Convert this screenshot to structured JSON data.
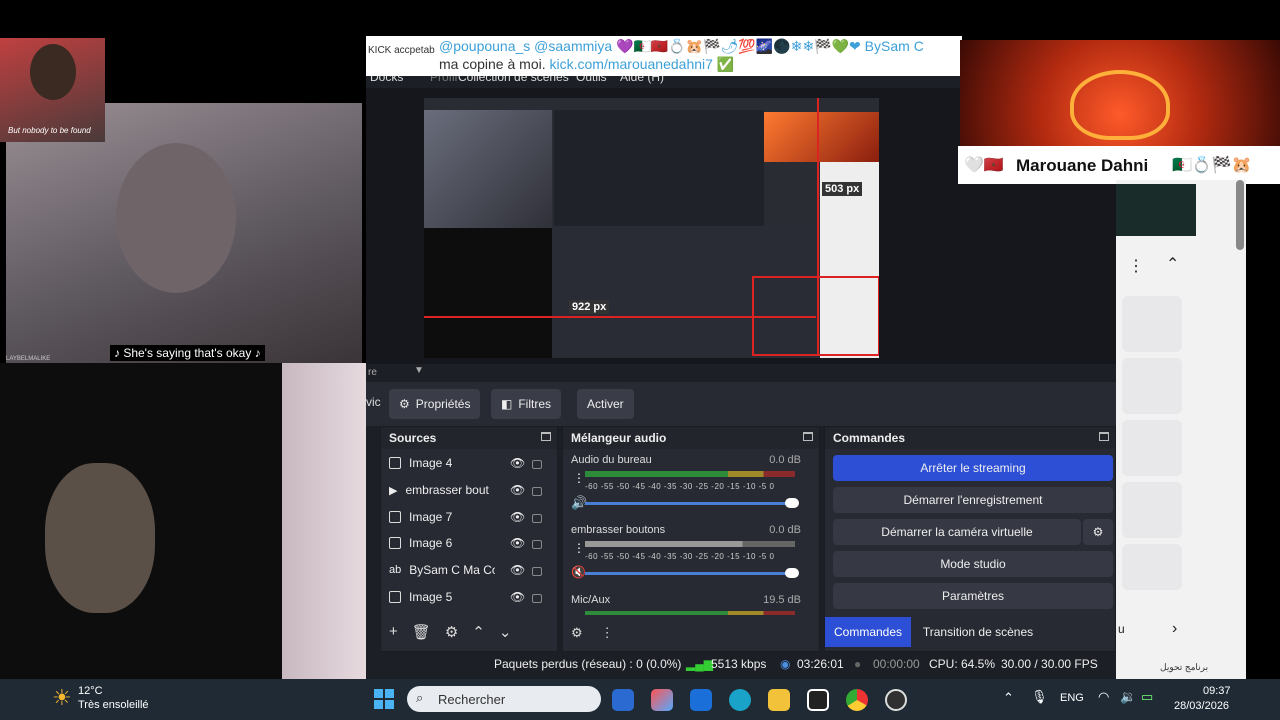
{
  "chat": {
    "kick_label": "KICK accpetab",
    "line1": "@poupouna_s  @saammiya 💜🇩🇿🇲🇦💍🐹🏁🌶💯🌌🌑❄❄🏁💚❤ BySam C",
    "line2_text": "ma copine à moi.",
    "line2_link": "kick.com/marouanedahni7",
    "check": "✅"
  },
  "avatar": {
    "caption": "But nobody to be found"
  },
  "video": {
    "subtitle": "♪ She's saying that's okay ♪",
    "watermark": "LAYBELMALIKE"
  },
  "nameplate": {
    "emoji_left": "🤍🇲🇦",
    "name": "Marouane Dahni",
    "emoji_right": "🇩🇿💍🏁🐹"
  },
  "obs": {
    "menu": [
      "Docks",
      "Profil",
      "Collection de scènes",
      "Outils",
      "Aide (H)"
    ],
    "preview_labels": {
      "px_top": "503 px",
      "px_left": "922 px"
    },
    "scene_label": "re",
    "toolbar": {
      "props": "Propriétés",
      "filters": "Filtres",
      "activate": "Activer",
      "left_cut": "vic"
    },
    "sources": {
      "title": "Sources",
      "items": [
        "Image 4",
        "embrasser bout",
        "Image 7",
        "Image 6",
        "BySam C Ma Co|",
        "Image 5"
      ]
    },
    "mixer": {
      "title": "Mélangeur audio",
      "channels": [
        {
          "name": "Audio du bureau",
          "db": "0.0 dB",
          "level": 0.85
        },
        {
          "name": "embrasser boutons",
          "db": "0.0 dB",
          "level": 0.72
        },
        {
          "name": "Mic/Aux",
          "db": "19.5 dB",
          "level": 0.36
        }
      ],
      "ticks": "-60 -55 -50 -45 -40 -35 -30 -25 -20 -15 -10 -5 0"
    },
    "commands": {
      "title": "Commandes",
      "stop_stream": "Arrêter le streaming",
      "start_rec": "Démarrer l'enregistrement",
      "start_vcam": "Démarrer la caméra virtuelle",
      "studio": "Mode studio",
      "settings": "Paramètres",
      "tab1": "Commandes",
      "tab2": "Transition de scènes"
    },
    "status": {
      "dropped": "Paquets perdus (réseau) : 0 (0.0%)",
      "kbps": "5513 kbps",
      "stream_time": "03:26:01",
      "rec_time": "00:00:00",
      "cpu": "CPU: 64.5%",
      "fps": "30.00 / 30.00 FPS"
    }
  },
  "browser": {
    "label_u": "u",
    "arabic": "برنامج تحويل"
  },
  "taskbar": {
    "weather_temp": "12°C",
    "weather_desc": "Très ensoleillé",
    "search_placeholder": "Rechercher",
    "lang": "ENG",
    "time": "09:37",
    "date": "28/03/2026"
  },
  "colors": {
    "accent_blue": "#2d4fd6",
    "obs_bg": "#272a33",
    "chat_link": "#3da0d9"
  }
}
